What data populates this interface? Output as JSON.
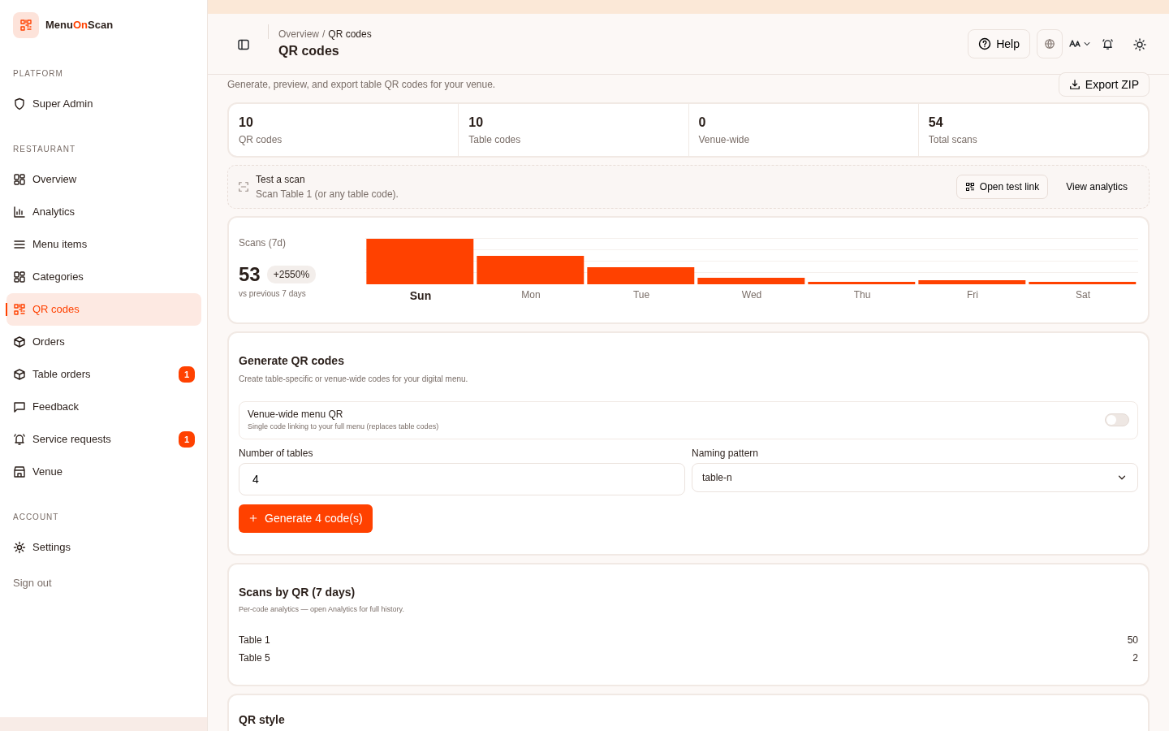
{
  "brand": {
    "prefix": "Menu",
    "accent": "On",
    "suffix": "Scan"
  },
  "sidebar": {
    "sections": [
      {
        "title": "PLATFORM",
        "items": [
          {
            "label": "Super Admin",
            "kind": "shield",
            "selected": false
          }
        ]
      },
      {
        "title": "RESTAURANT",
        "items": [
          {
            "label": "Overview",
            "kind": "grid",
            "selected": false
          },
          {
            "label": "Analytics",
            "kind": "chart",
            "selected": false
          },
          {
            "label": "Menu items",
            "kind": "list",
            "selected": false
          },
          {
            "label": "Categories",
            "kind": "grid",
            "selected": false
          },
          {
            "label": "QR codes",
            "kind": "qr",
            "selected": true
          },
          {
            "label": "Orders",
            "kind": "box",
            "selected": false
          },
          {
            "label": "Table orders",
            "kind": "box",
            "selected": false,
            "badge": "1"
          },
          {
            "label": "Feedback",
            "kind": "chat",
            "selected": false
          },
          {
            "label": "Service requests",
            "kind": "bell",
            "selected": false,
            "badge": "1"
          },
          {
            "label": "Venue",
            "kind": "store",
            "selected": false
          }
        ]
      },
      {
        "title": "ACCOUNT",
        "items": [
          {
            "label": "Settings",
            "kind": "gear",
            "selected": false
          }
        ]
      }
    ],
    "sign_out": "Sign out"
  },
  "header": {
    "breadcrumb": [
      "Overview",
      "QR codes"
    ],
    "breadcrumb_separator": "/",
    "title": "QR codes",
    "help": "Help"
  },
  "subtitle": "Generate, preview, and export table QR codes for your venue.",
  "export_button": "Export ZIP",
  "stats": [
    {
      "value": "10",
      "label": "QR codes"
    },
    {
      "value": "10",
      "label": "Table codes"
    },
    {
      "value": "0",
      "label": "Venue-wide"
    },
    {
      "value": "54",
      "label": "Total scans"
    }
  ],
  "test_scan": {
    "title": "Test a scan",
    "text": "Scan Table 1 (or any table code).",
    "open_link": "Open test link",
    "view_analytics": "View analytics"
  },
  "scans": {
    "label": "Scans (7d)",
    "value": "53",
    "change": "+2550%",
    "note": "vs previous 7 days",
    "days": [
      {
        "label": "Sun",
        "selected": true
      },
      {
        "label": "Mon",
        "selected": false
      },
      {
        "label": "Tue",
        "selected": false
      },
      {
        "label": "Wed",
        "selected": false
      },
      {
        "label": "Thu",
        "selected": false
      },
      {
        "label": "Fri",
        "selected": false
      },
      {
        "label": "Sat",
        "selected": false
      }
    ]
  },
  "generate": {
    "title": "Generate QR codes",
    "description": "Create table-specific or venue-wide codes for your digital menu.",
    "venue_wide": {
      "title": "Venue-wide menu QR",
      "description": "Single code linking to your full menu (replaces table codes)",
      "on": false
    },
    "tables_label": "Number of tables",
    "tables_value": "4",
    "pattern_label": "Naming pattern",
    "pattern_value": "table-n",
    "button": "Generate 4 code(s)"
  },
  "by_qr": {
    "title": "Scans by QR (7 days)",
    "description": "Per-code analytics — open Analytics for full history.",
    "rows": [
      {
        "name": "Table 1",
        "count": "50"
      },
      {
        "name": "Table 5",
        "count": "2"
      }
    ]
  },
  "qr_style": {
    "title": "QR style"
  }
}
